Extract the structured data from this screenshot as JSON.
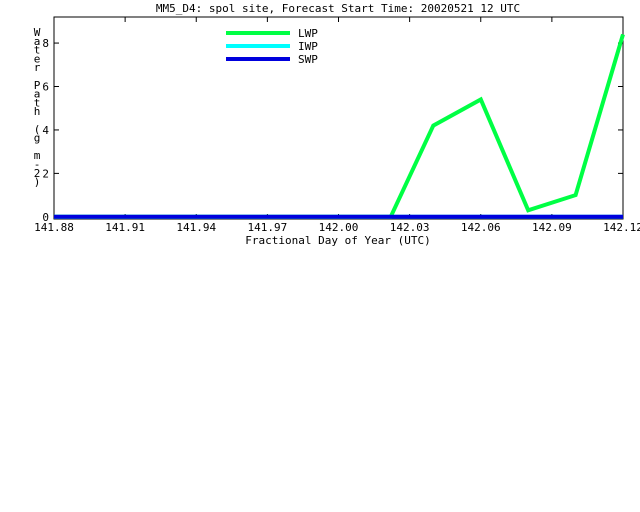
{
  "chart_data": {
    "type": "line",
    "title": "MM5_D4: spol site,  Forecast Start Time: 20020521 12 UTC",
    "xlabel": "Fractional Day of Year (UTC)",
    "ylabel": "Water Path (g m-2)",
    "ylabel_chars": [
      "W",
      "a",
      "t",
      "e",
      "r",
      " ",
      "P",
      "a",
      "t",
      "h",
      " ",
      "(",
      "g",
      " ",
      "m",
      "-",
      "2",
      ")"
    ],
    "xlim": [
      141.88,
      142.12
    ],
    "ylim": [
      -0.1,
      9.2
    ],
    "x_ticks": [
      141.88,
      141.91,
      141.94,
      141.97,
      142.0,
      142.03,
      142.06,
      142.09,
      142.12
    ],
    "x_tick_labels": [
      "141.88",
      "141.91",
      "141.94",
      "141.97",
      "142.00",
      "142.03",
      "142.06",
      "142.09",
      "142.12"
    ],
    "y_ticks": [
      0,
      2,
      4,
      6,
      8
    ],
    "y_tick_labels": [
      "0",
      "2",
      "4",
      "6",
      "8"
    ],
    "legend_position": "top-left",
    "series": [
      {
        "name": "LWP",
        "color": "#00ff44",
        "x": [
          141.88,
          142.01,
          142.022,
          142.04,
          142.06,
          142.08,
          142.1,
          142.12
        ],
        "y": [
          0,
          0,
          0,
          4.2,
          5.4,
          0.3,
          1.0,
          8.4
        ]
      },
      {
        "name": "IWP",
        "color": "#00ffff",
        "x": [
          141.88,
          142.12
        ],
        "y": [
          0,
          0
        ]
      },
      {
        "name": "SWP",
        "color": "#0000dd",
        "x": [
          141.88,
          142.12
        ],
        "y": [
          0,
          0
        ]
      }
    ]
  }
}
